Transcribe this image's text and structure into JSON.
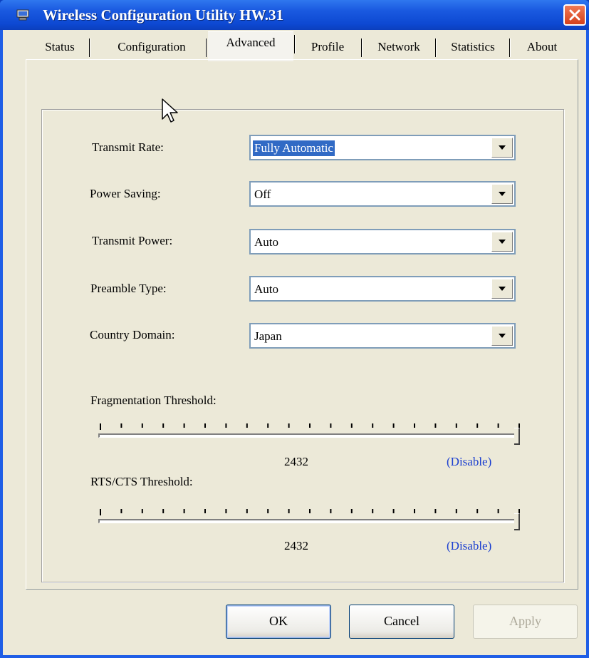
{
  "window": {
    "title": "Wireless Configuration Utility HW.31",
    "icon": "network-adapter-icon"
  },
  "tabs": [
    {
      "label": "Status"
    },
    {
      "label": "Configuration"
    },
    {
      "label": "Advanced",
      "active": true
    },
    {
      "label": "Profile"
    },
    {
      "label": "Network"
    },
    {
      "label": "Statistics"
    },
    {
      "label": "About"
    }
  ],
  "advanced": {
    "transmit_rate": {
      "label": "Transmit Rate:",
      "value": "Fully Automatic"
    },
    "power_saving": {
      "label": "Power Saving:",
      "value": "Off"
    },
    "transmit_power": {
      "label": "Transmit Power:",
      "value": "Auto"
    },
    "preamble_type": {
      "label": "Preamble Type:",
      "value": "Auto"
    },
    "country_domain": {
      "label": "Country Domain:",
      "value": "Japan"
    },
    "fragmentation": {
      "label": "Fragmentation Threshold:",
      "value": "2432",
      "status": "(Disable)",
      "level": 1.0
    },
    "rts_cts": {
      "label": "RTS/CTS Threshold:",
      "value": "2432",
      "status": "(Disable)",
      "level": 1.0
    }
  },
  "buttons": {
    "ok": "OK",
    "cancel": "Cancel",
    "apply": "Apply"
  },
  "colors": {
    "titlebar": "#0b48d2",
    "selection": "#316ac5",
    "link": "#1b3fd0"
  }
}
